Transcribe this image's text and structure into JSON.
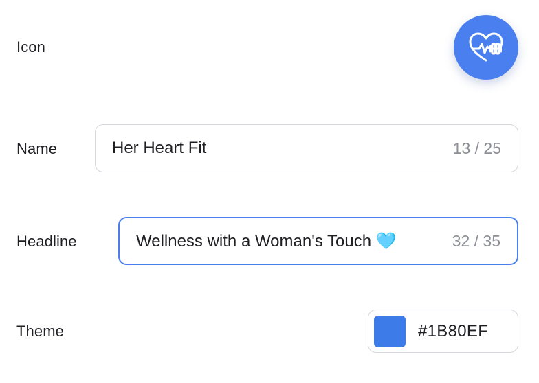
{
  "icon": {
    "label": "Icon",
    "glyph": "heart-dumbbell-icon",
    "background": "#4A7FF0"
  },
  "name": {
    "label": "Name",
    "value": "Her Heart Fit",
    "counter": "13 / 25"
  },
  "headline": {
    "label": "Headline",
    "value": "Wellness with a Woman's Touch 🩵",
    "counter": "32 / 35"
  },
  "theme": {
    "label": "Theme",
    "hex": "#1B80EF",
    "swatch_color": "#3D7BE8"
  },
  "colors": {
    "accent": "#4A7FF0",
    "border": "#D4D6DC",
    "muted_text": "#8D8F96"
  }
}
